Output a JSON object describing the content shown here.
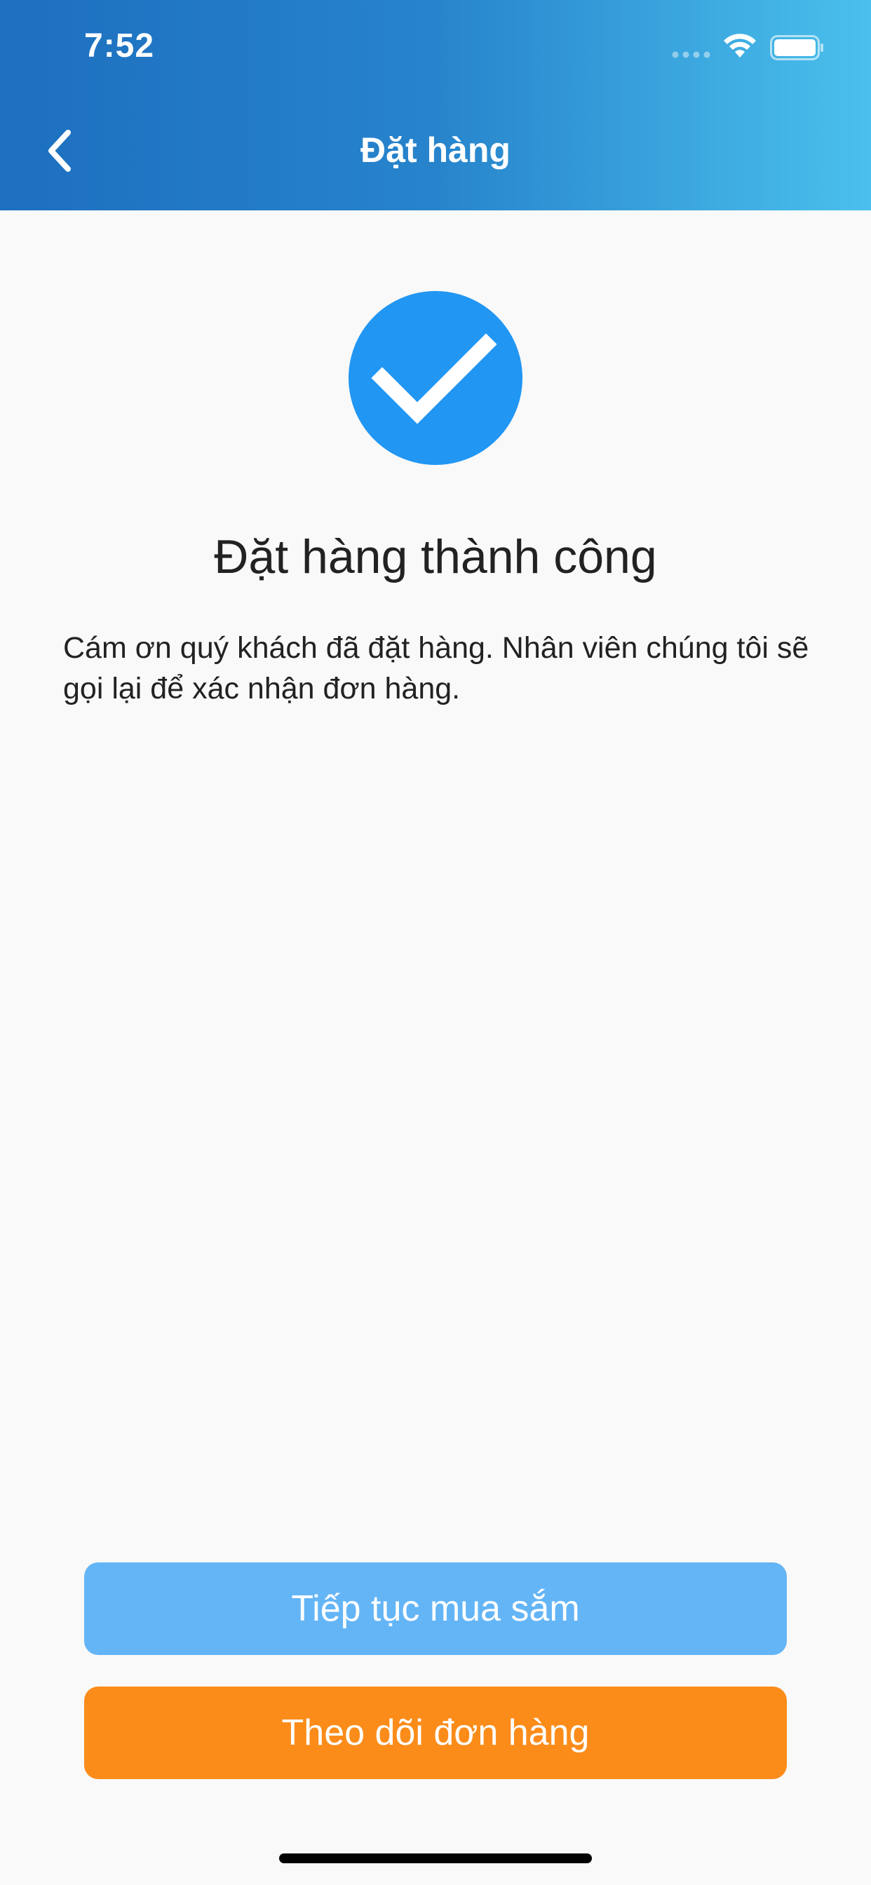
{
  "status_bar": {
    "time": "7:52"
  },
  "nav": {
    "title": "Đặt hàng",
    "back_icon": "chevron-left-icon"
  },
  "success": {
    "icon": "checkmark-circle-icon",
    "icon_color": "#2196f3",
    "title": "Đặt hàng thành công",
    "message": "Cám ơn quý khách đã đặt hàng. Nhân viên chúng tôi sẽ gọi lại để xác nhận đơn hàng."
  },
  "actions": {
    "continue_label": "Tiếp tục mua sắm",
    "continue_color": "#64b5f6",
    "track_label": "Theo dõi đơn hàng",
    "track_color": "#fb8c1a"
  },
  "colors": {
    "header_start": "#1d6fbf",
    "header_end": "#4ac0ec",
    "background": "#f9f9f9"
  }
}
